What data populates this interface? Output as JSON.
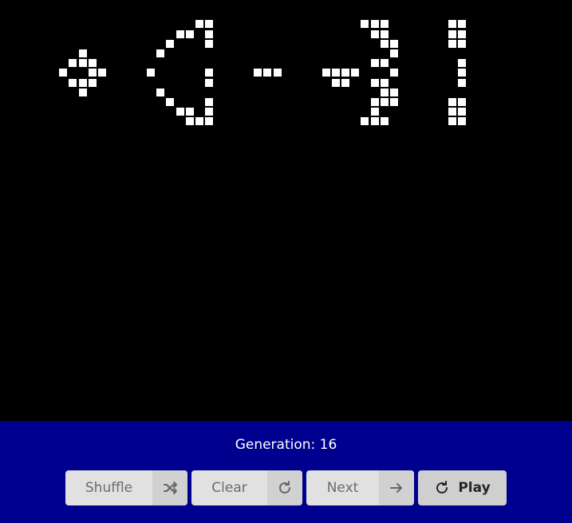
{
  "status": {
    "generation_label": "Generation: 16"
  },
  "buttons": {
    "shuffle": {
      "label": "Shuffle",
      "icon": "shuffle-icon"
    },
    "clear": {
      "label": "Clear",
      "icon": "rotate-icon"
    },
    "next": {
      "label": "Next",
      "icon": "arrow-right-icon"
    },
    "play": {
      "label": "Play",
      "icon": "rotate-icon"
    }
  },
  "colors": {
    "board_background": "#000000",
    "live_cell": "#ffffff",
    "panel_background": "#00008f",
    "button_background": "#e1e1e1"
  }
}
